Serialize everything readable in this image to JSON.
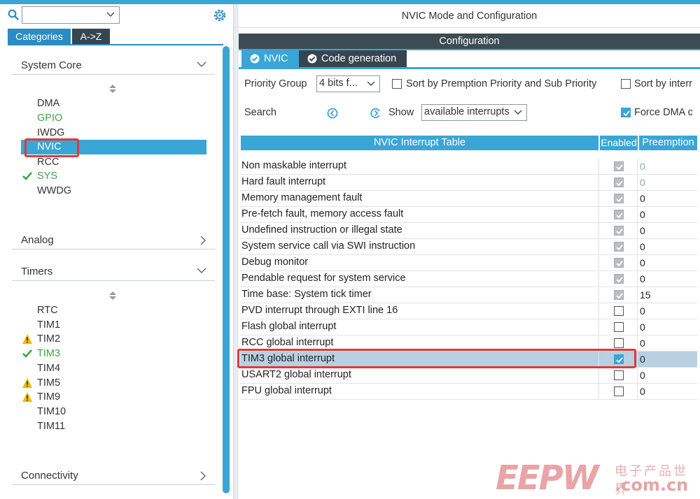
{
  "left": {
    "tabs": {
      "categories": "Categories",
      "az": "A->Z"
    },
    "sections": {
      "system_core": "System Core",
      "analog": "Analog",
      "timers": "Timers",
      "connectivity": "Connectivity"
    },
    "system_core_items": [
      "DMA",
      "GPIO",
      "IWDG",
      "NVIC",
      "RCC",
      "SYS",
      "WWDG"
    ],
    "timer_items": [
      "RTC",
      "TIM1",
      "TIM2",
      "TIM3",
      "TIM4",
      "TIM5",
      "TIM9",
      "TIM10",
      "TIM11"
    ]
  },
  "right": {
    "mode_title": "NVIC Mode and Configuration",
    "config_title": "Configuration",
    "tabs": {
      "nvic": "NVIC",
      "code_generation": "Code generation"
    },
    "priority_group_label": "Priority Group",
    "priority_group_value": "4 bits f...",
    "sort_premption_label": "Sort by Premption Priority and Sub Priority",
    "sort_by_label": "Sort by interr",
    "search_label": "Search",
    "show_label": "Show",
    "show_value": "available interrupts",
    "force_dma_label": "Force DMA c",
    "table": {
      "header_name": "NVIC Interrupt Table",
      "header_enabled": "Enabled",
      "header_preemption": "Preemption",
      "rows": [
        {
          "name": "Non maskable interrupt",
          "preemption": "0"
        },
        {
          "name": "Hard fault interrupt",
          "preemption": "0"
        },
        {
          "name": "Memory management fault",
          "preemption": "0"
        },
        {
          "name": "Pre-fetch fault, memory access fault",
          "preemption": "0"
        },
        {
          "name": "Undefined instruction or illegal state",
          "preemption": "0"
        },
        {
          "name": "System service call via SWI instruction",
          "preemption": "0"
        },
        {
          "name": "Debug monitor",
          "preemption": "0"
        },
        {
          "name": "Pendable request for system service",
          "preemption": "0"
        },
        {
          "name": "Time base: System tick timer",
          "preemption": "15"
        },
        {
          "name": "PVD interrupt through EXTI line 16",
          "preemption": "0"
        },
        {
          "name": "Flash global interrupt",
          "preemption": "0"
        },
        {
          "name": "RCC global interrupt",
          "preemption": "0"
        },
        {
          "name": "TIM3 global interrupt",
          "preemption": "0"
        },
        {
          "name": "USART2 global interrupt",
          "preemption": "0"
        },
        {
          "name": "FPU global interrupt",
          "preemption": "0"
        }
      ]
    }
  },
  "watermark": {
    "letters": "EEPW",
    "chinese": "电子产品世界",
    "url": ".com.cn"
  },
  "colors": {
    "accent": "#39a6d6",
    "dark_tab": "#35464f",
    "highlight_red": "#e03a3a",
    "ok_green": "#3aa843",
    "warn_yellow": "#f2b705"
  }
}
